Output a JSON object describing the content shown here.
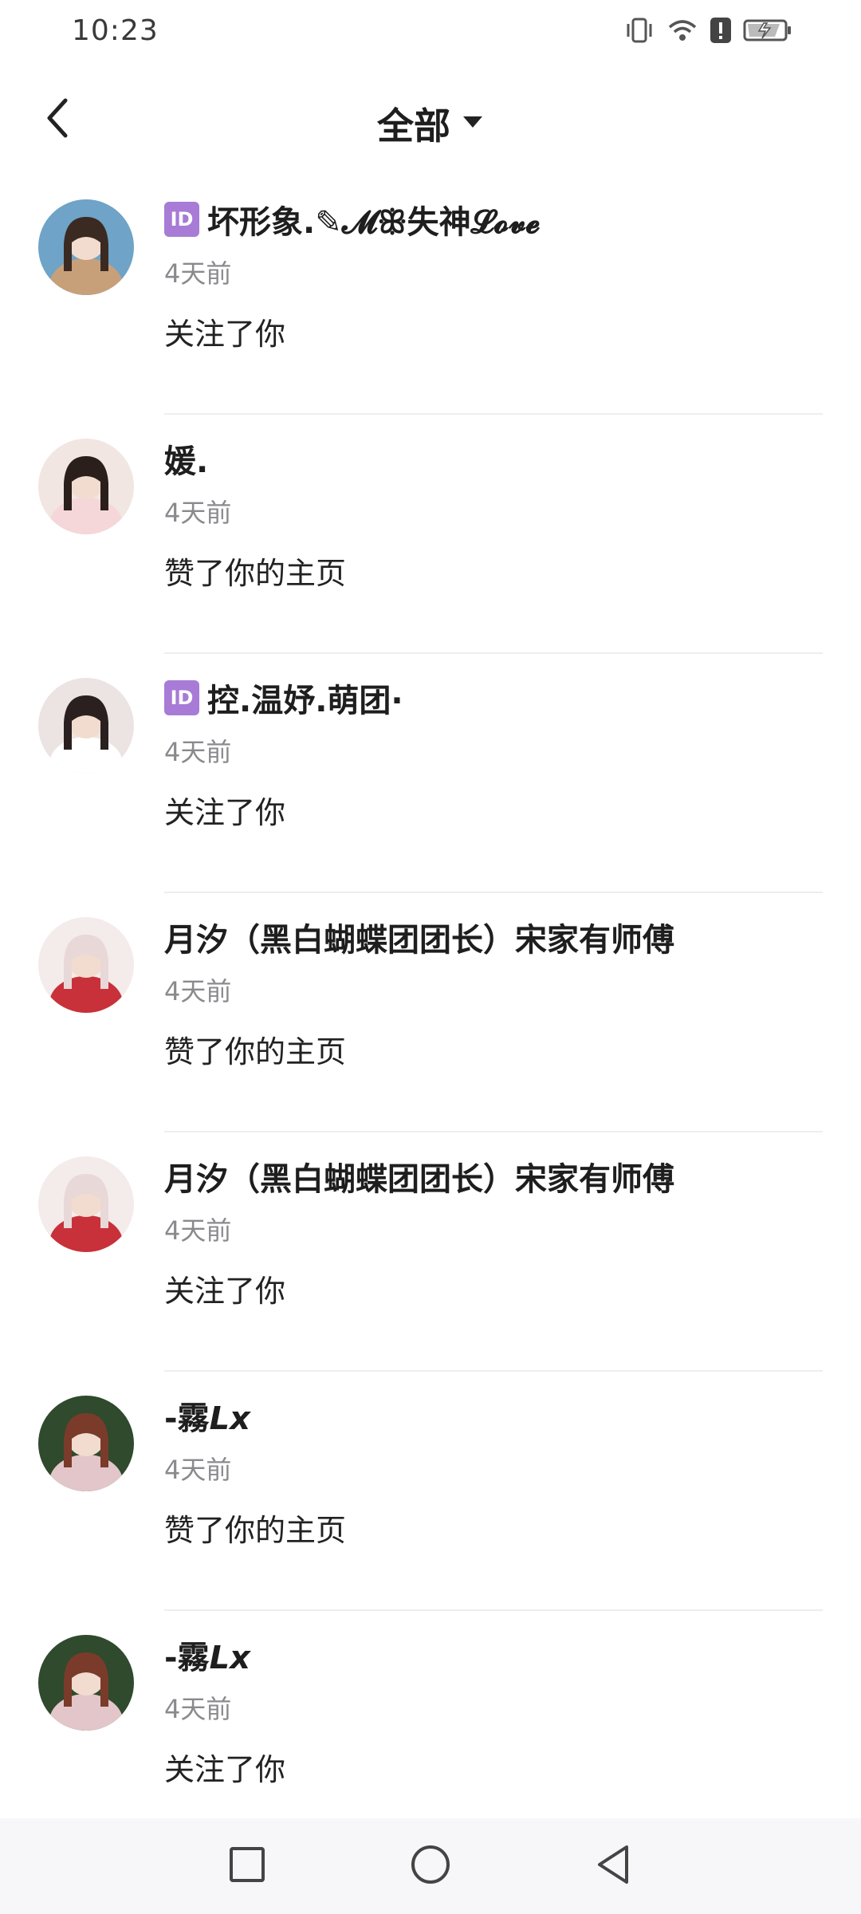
{
  "status_bar": {
    "time": "10:23",
    "icons": [
      "vibrate-icon",
      "wifi-icon",
      "alert-icon",
      "battery-charging-icon"
    ]
  },
  "header": {
    "back_icon": "chevron-left-icon",
    "title": "全部",
    "dropdown_icon": "caret-down-icon"
  },
  "notifications": [
    {
      "name": "坏形象.✎𝓜ꕥ失神𝓛𝓸𝓿𝓮",
      "has_id_badge": true,
      "id_badge_text": "ID",
      "time": "4天前",
      "action": "关注了你",
      "avatar_colors": [
        "#6fa3c7",
        "#c7a07a",
        "#3b2a22"
      ]
    },
    {
      "name": "媛.",
      "has_id_badge": false,
      "time": "4天前",
      "action": "赞了你的主页",
      "avatar_colors": [
        "#f1e6e1",
        "#f5d6d9",
        "#2b1f1c"
      ]
    },
    {
      "name": "控.温妤.萌团·",
      "has_id_badge": true,
      "id_badge_text": "ID",
      "time": "4天前",
      "action": "关注了你",
      "avatar_colors": [
        "#ece4e2",
        "#ffffff",
        "#2a2020"
      ]
    },
    {
      "name": "月汐（黑白蝴蝶团团长）宋家有师傅",
      "has_id_badge": false,
      "time": "4天前",
      "action": "赞了你的主页",
      "avatar_colors": [
        "#f4ecea",
        "#c8313a",
        "#e9d8d8"
      ]
    },
    {
      "name": "月汐（黑白蝴蝶团团长）宋家有师傅",
      "has_id_badge": false,
      "time": "4天前",
      "action": "关注了你",
      "avatar_colors": [
        "#f4ecea",
        "#c8313a",
        "#e9d8d8"
      ]
    },
    {
      "name": "-霧𝙇𝙭",
      "has_id_badge": false,
      "time": "4天前",
      "action": "赞了你的主页",
      "avatar_colors": [
        "#2f4a2c",
        "#e3c6c9",
        "#7a3b2a"
      ]
    },
    {
      "name": "-霧𝙇𝙭",
      "has_id_badge": false,
      "time": "4天前",
      "action": "关注了你",
      "avatar_colors": [
        "#2f4a2c",
        "#e3c6c9",
        "#7a3b2a"
      ]
    }
  ],
  "nav_bar": {
    "buttons": [
      "recent-apps-square-icon",
      "home-circle-icon",
      "back-triangle-icon"
    ]
  }
}
